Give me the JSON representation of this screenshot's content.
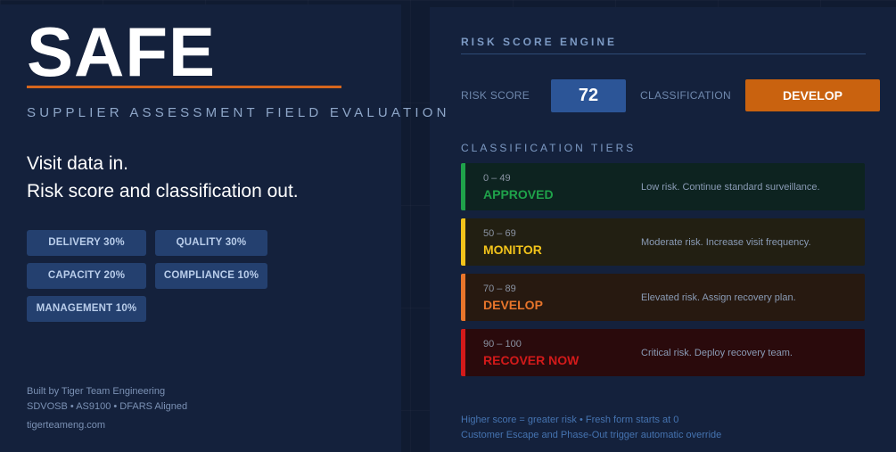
{
  "app": {
    "title": "SAFE",
    "subtitle": "SUPPLIER ASSESSMENT FIELD EVALUATION",
    "tagline_1": "Visit data in.",
    "tagline_2": "Risk score and classification out.",
    "accent_color": "#d6661d"
  },
  "weights": [
    {
      "label": "DELIVERY 30%"
    },
    {
      "label": "QUALITY 30%"
    },
    {
      "label": "CAPACITY 20%"
    },
    {
      "label": "COMPLIANCE 10%"
    },
    {
      "label": "MANAGEMENT 10%"
    }
  ],
  "footer": {
    "built_by": "Built by Tiger Team Engineering",
    "certs": "SDVOSB • AS9100 • DFARS Aligned",
    "site": "tigerteameng.com"
  },
  "engine": {
    "heading": "RISK SCORE ENGINE",
    "score_label": "RISK SCORE",
    "score_value": "72",
    "classification_label": "CLASSIFICATION",
    "classification_value": "DEVELOP",
    "classification_color": "#c9620f"
  },
  "tiers": {
    "heading": "CLASSIFICATION TIERS",
    "items": [
      {
        "range": "0 – 49",
        "name": "APPROVED",
        "desc": "Low risk. Continue standard surveillance.",
        "color": "#1fa24a",
        "bg": "#0d2320"
      },
      {
        "range": "50 – 69",
        "name": "MONITOR",
        "desc": "Moderate risk. Increase visit frequency.",
        "color": "#f2c31b",
        "bg": "#221f12"
      },
      {
        "range": "70 – 89",
        "name": "DEVELOP",
        "desc": "Elevated risk. Assign recovery plan.",
        "color": "#e8752b",
        "bg": "#271910"
      },
      {
        "range": "90 – 100",
        "name": "RECOVER NOW",
        "desc": "Critical risk. Deploy recovery team.",
        "color": "#d31a1a",
        "bg": "#2a0a0c"
      }
    ]
  },
  "notes": {
    "line_1": "Higher score = greater risk • Fresh form starts at 0",
    "line_2": "Customer Escape and Phase-Out trigger automatic override"
  }
}
